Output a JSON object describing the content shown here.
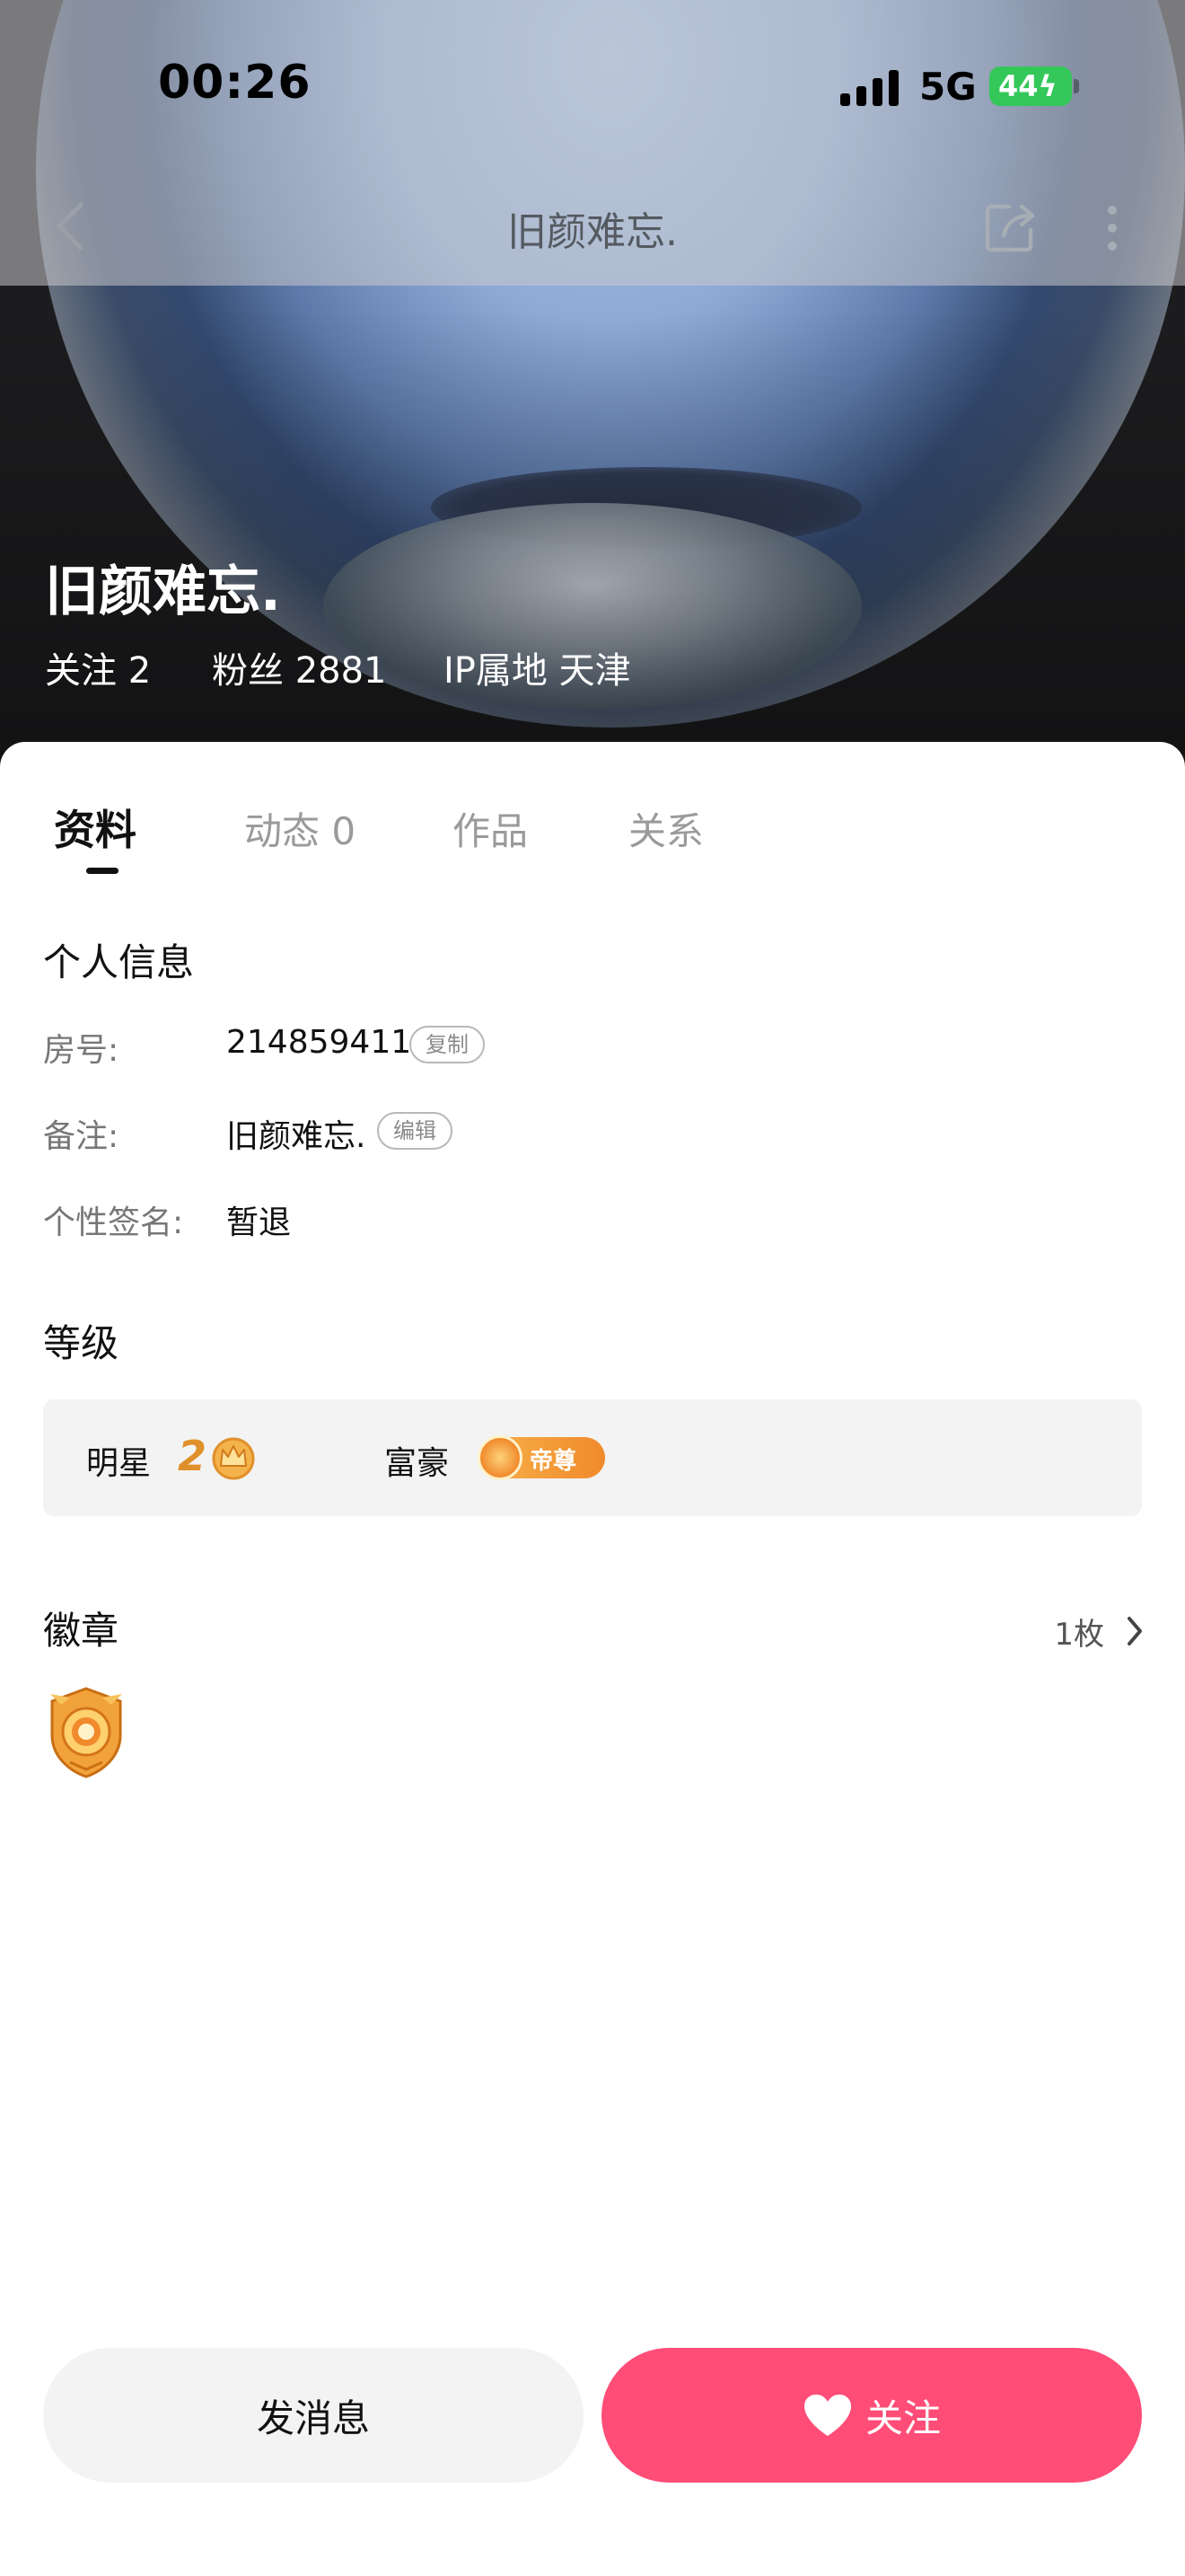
{
  "status_bar": {
    "time": "00:26",
    "network": "5G",
    "battery": "44"
  },
  "nav": {
    "title": "旧颜难忘."
  },
  "profile": {
    "name": "旧颜难忘.",
    "following": "关注 2",
    "fans": "粉丝 2881",
    "ip": "IP属地 天津"
  },
  "tabs": [
    {
      "label": "资料",
      "active": true
    },
    {
      "label": "动态 0",
      "active": false
    },
    {
      "label": "作品",
      "active": false
    },
    {
      "label": "关系",
      "active": false
    }
  ],
  "personal_info": {
    "title": "个人信息",
    "room_label": "房号:",
    "room_value": "214859411",
    "copy_chip": "复制",
    "remark_label": "备注:",
    "remark_value": "旧颜难忘.",
    "edit_chip": "编辑",
    "signature_label": "个性签名:",
    "signature_value": "暂退"
  },
  "levels": {
    "title": "等级",
    "star_label": "明星",
    "star_level": "2",
    "rich_label": "富豪",
    "rich_badge": "帝尊"
  },
  "badges": {
    "title": "徽章",
    "count": "1枚"
  },
  "actions": {
    "message": "发消息",
    "follow": "关注"
  },
  "colors": {
    "accent": "#ff4d78",
    "battery": "#34c759",
    "rich_badge": "#f08a2c",
    "crown": "#e0902a"
  },
  "icons": [
    "signal-icon",
    "back-arrow-icon",
    "share-icon",
    "more-icon",
    "crown-icon",
    "coin-icon",
    "chevron-right-icon",
    "medal-icon",
    "heart-icon"
  ]
}
